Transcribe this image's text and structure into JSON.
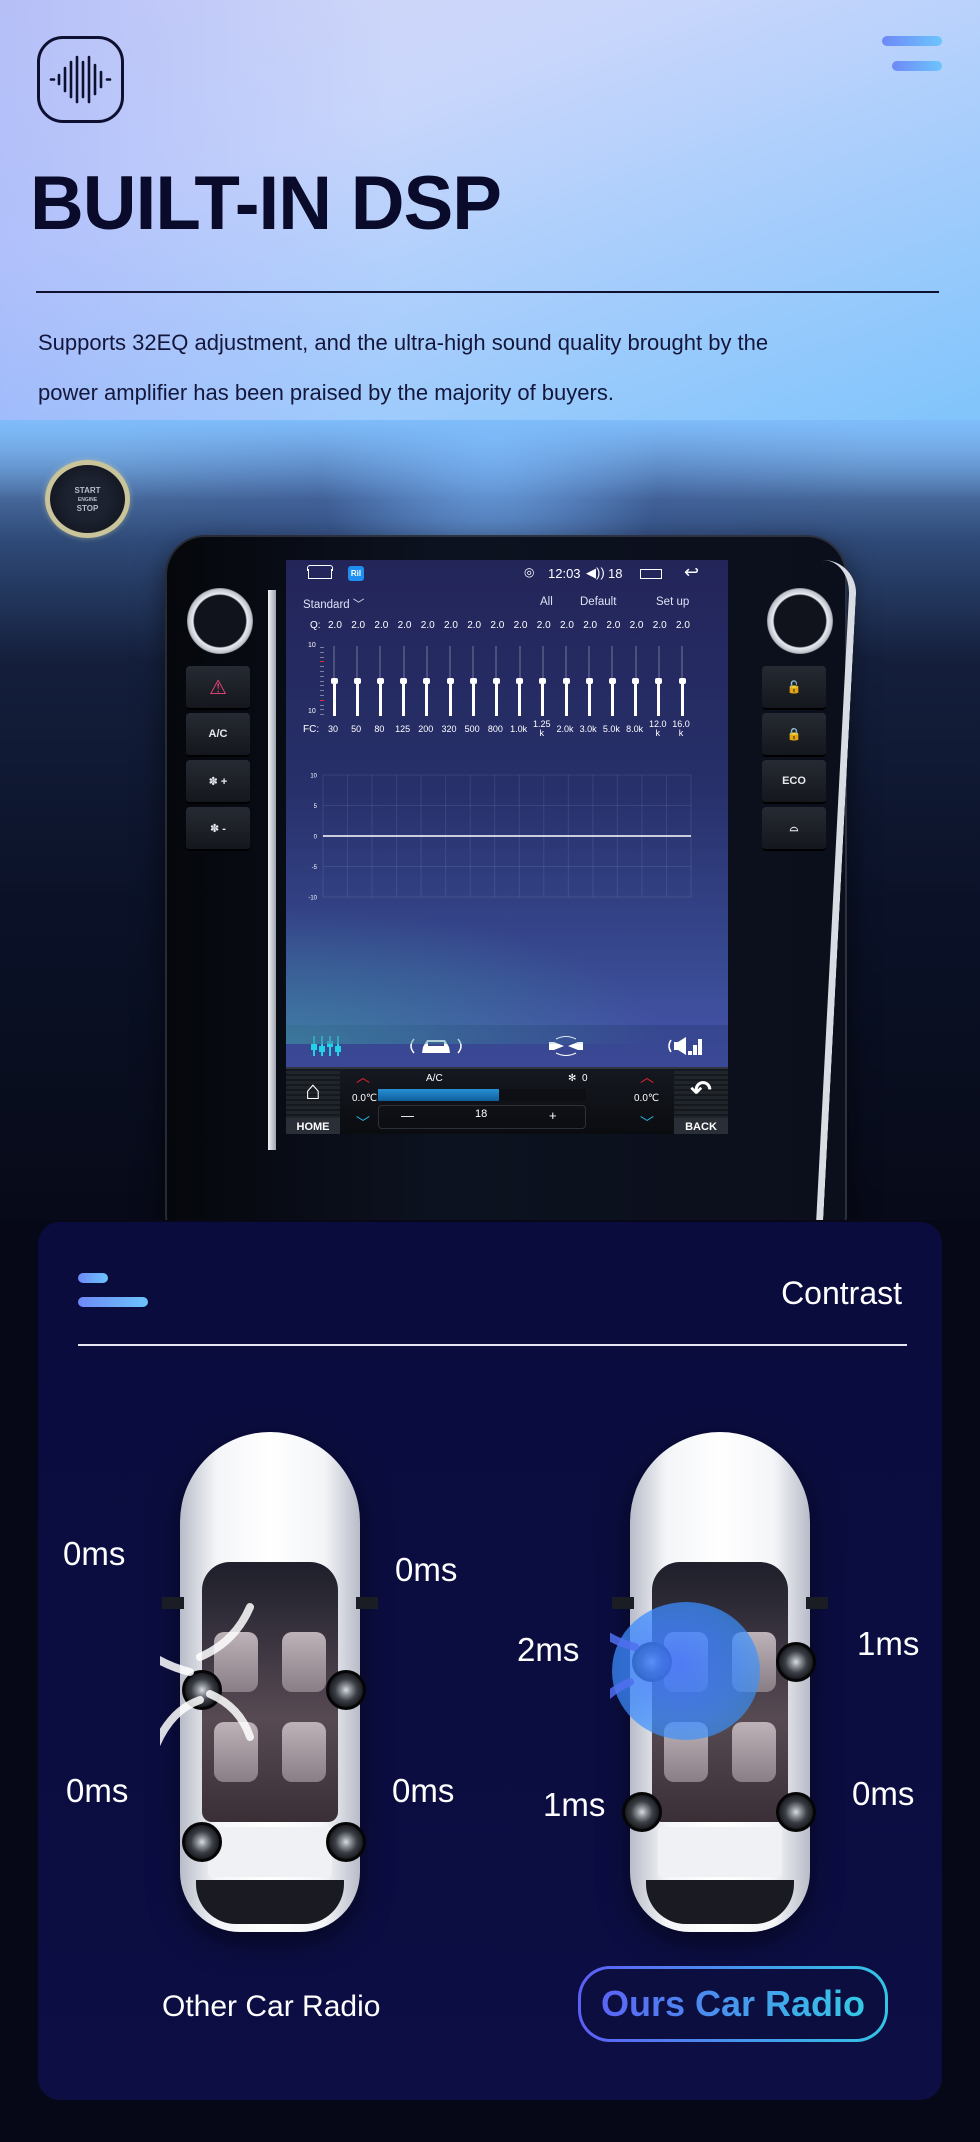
{
  "hero": {
    "title": "BUILT-IN DSP",
    "description_line1": "Supports 32EQ adjustment, and the ultra-high sound quality brought by the",
    "description_line2": "power amplifier has been praised by the majority of buyers.",
    "logo_icon": "sound-wave-icon",
    "menu_icon": "menu-icon"
  },
  "dashboard": {
    "start_button": {
      "line1": "START",
      "line2": "ENGINE",
      "line3": "STOP"
    },
    "left_buttons": [
      {
        "icon": "hazard-icon",
        "label": "⚠"
      },
      {
        "icon": "ac-icon",
        "label": "A/C"
      },
      {
        "icon": "fan-plus-icon",
        "label": "✽ +"
      },
      {
        "icon": "fan-minus-icon",
        "label": "✽ -"
      }
    ],
    "right_buttons": [
      {
        "icon": "unlock-icon",
        "label": "🔓"
      },
      {
        "icon": "lock-icon",
        "label": "🔒"
      },
      {
        "icon": "eco-icon",
        "label": "ECO"
      },
      {
        "icon": "defrost-icon",
        "label": "⌓"
      }
    ],
    "screen": {
      "status_bar": {
        "app_icon_label": "Ril",
        "signal_glyph": "◎",
        "time": "12:03",
        "volume_glyph": "◀))",
        "volume": "18",
        "back_glyph": "↩"
      },
      "eq": {
        "preset": "Standard ﹀",
        "all_label": "All",
        "default_label": "Default",
        "setup_label": "Set up",
        "q_label": "Q:",
        "q_values": [
          "2.0",
          "2.0",
          "2.0",
          "2.0",
          "2.0",
          "2.0",
          "2.0",
          "2.0",
          "2.0",
          "2.0",
          "2.0",
          "2.0",
          "2.0",
          "2.0",
          "2.0",
          "2.0"
        ],
        "scale_top": "10",
        "scale_bottom": "10",
        "fc_label": "FC:",
        "fc_values": [
          "30",
          "50",
          "80",
          "125",
          "200",
          "320",
          "500",
          "800",
          "1.0k",
          "1.25 k",
          "2.0k",
          "3.0k",
          "5.0k",
          "8.0k",
          "12.0 k",
          "16.0 k"
        ],
        "gains": [
          0,
          0,
          0,
          0,
          0,
          0,
          0,
          0,
          0,
          0,
          0,
          0,
          0,
          0,
          0,
          0
        ]
      },
      "curve": {
        "y_ticks": [
          "10",
          "5",
          "0",
          "-5",
          "-10"
        ],
        "ylim": [
          -10,
          10
        ],
        "values": [
          0,
          0,
          0,
          0,
          0,
          0,
          0,
          0,
          0,
          0,
          0,
          0,
          0,
          0,
          0,
          0
        ]
      },
      "tabs": [
        {
          "name": "equalizer-tab",
          "active": true
        },
        {
          "name": "car-sound-field-tab",
          "active": false
        },
        {
          "name": "balance-tab",
          "active": false
        },
        {
          "name": "sound-effects-tab",
          "active": false
        }
      ],
      "climate": {
        "home_label": "HOME",
        "back_label": "BACK",
        "ac_label": "A/C",
        "fan_level": "0",
        "left_temp": "0.0℃",
        "right_temp": "0.0℃",
        "fan_fill_percent": 58,
        "minus": "—",
        "plus": "+",
        "set_temp": "18"
      }
    }
  },
  "contrast": {
    "title": "Contrast",
    "other": {
      "label": "Other Car Radio",
      "front_left": "0ms",
      "front_right": "0ms",
      "rear_left": "0ms",
      "rear_right": "0ms"
    },
    "ours": {
      "label": "Ours Car Radio",
      "front_left": "2ms",
      "front_right": "1ms",
      "rear_left": "1ms",
      "rear_right": "0ms"
    }
  },
  "colors": {
    "accent_gradient_start": "#5b64f5",
    "accent_gradient_end": "#33c9e5",
    "eq_active_tab": "#22d3e6",
    "hazard": "#f0457a",
    "temp_up": "#e2262f",
    "temp_down": "#2bb6e0"
  }
}
